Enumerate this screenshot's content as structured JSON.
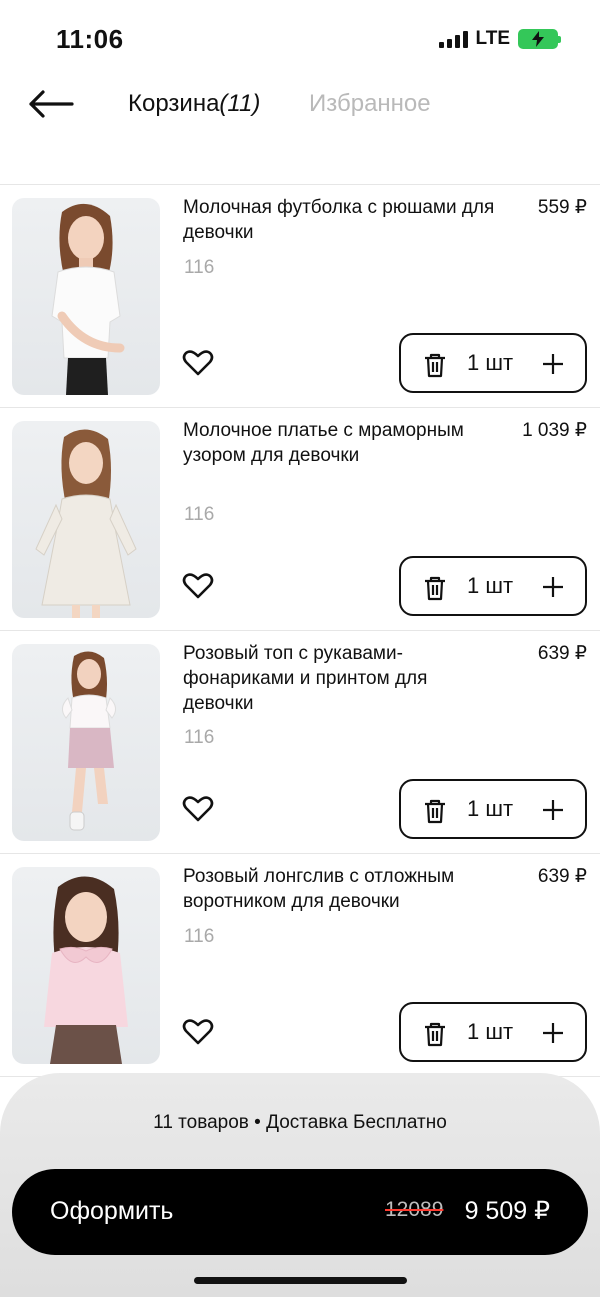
{
  "status_bar": {
    "time": "11:06",
    "network": "LTE"
  },
  "header": {
    "cart_tab_label": "Корзина",
    "cart_tab_count": "(11)",
    "favorites_tab_label": "Избранное"
  },
  "items": [
    {
      "title": "Молочная футболка с рюшами для девочки",
      "price": "559 ₽",
      "size": "116",
      "quantity": "1 шт",
      "outfit": "white-tee"
    },
    {
      "title": "Молочное платье с мраморным узором для девочки",
      "price": "1 039 ₽",
      "size": "116",
      "quantity": "1 шт",
      "outfit": "cream-dress"
    },
    {
      "title": "Розовый топ с рукавами-фонариками и принтом для девочки",
      "price": "639 ₽",
      "size": "116",
      "quantity": "1 шт",
      "outfit": "pink-top"
    },
    {
      "title": "Розовый лонгслив с отложным воротником для девочки",
      "price": "639 ₽",
      "size": "116",
      "quantity": "1 шт",
      "outfit": "pink-longsleeve"
    }
  ],
  "summary": {
    "text": "11 товаров • Доставка Бесплатно"
  },
  "checkout": {
    "label": "Оформить",
    "old_price": "12089",
    "price": "9 509 ₽"
  },
  "colors": {
    "accent": "#000000",
    "muted": "#a9a9a9",
    "strike": "#ff3b30",
    "battery": "#34c759"
  },
  "icons": [
    "back-arrow-icon",
    "heart-icon",
    "trash-icon",
    "plus-icon",
    "signal-icon",
    "battery-icon"
  ]
}
